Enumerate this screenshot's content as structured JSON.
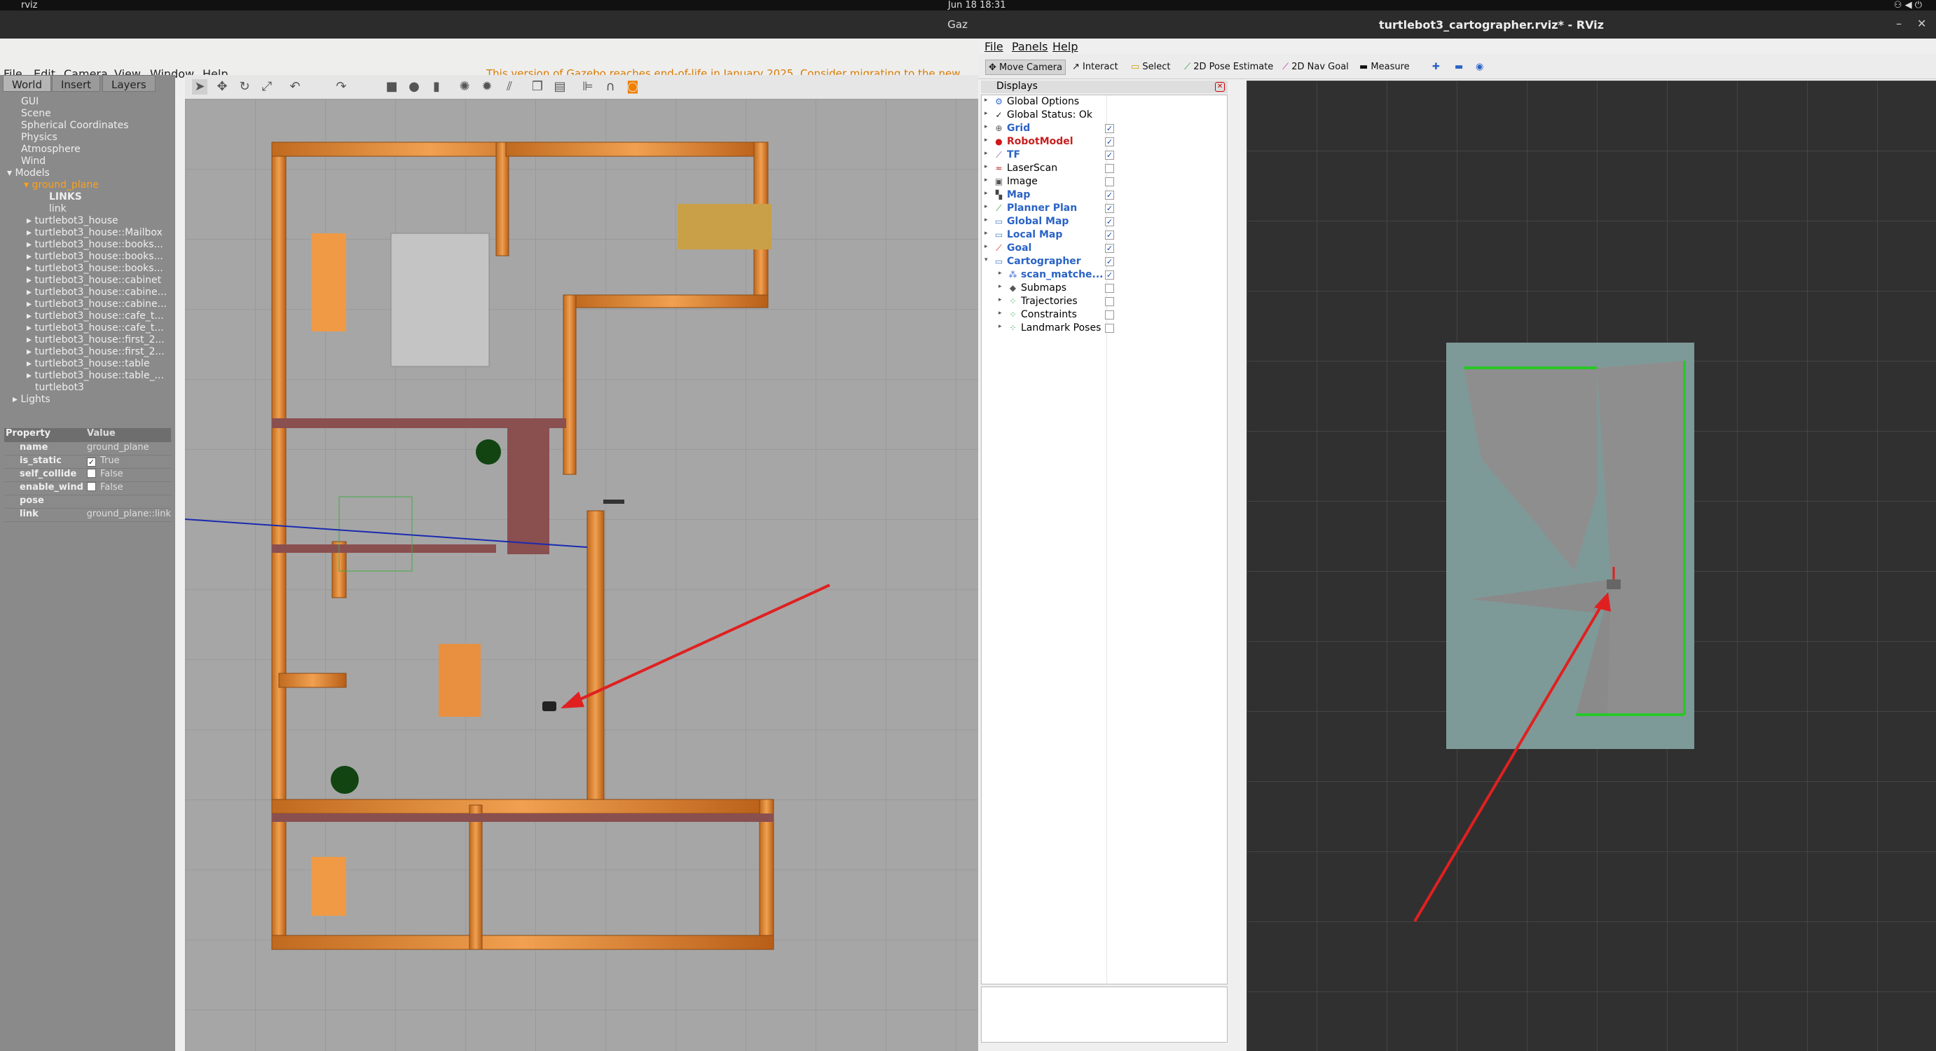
{
  "system": {
    "app": "rviz",
    "datetime": "Jun 18  18:31"
  },
  "gazebo": {
    "window_title": "Gaz",
    "menu": [
      "File",
      "Edit",
      "Camera",
      "View",
      "Window",
      "Help"
    ],
    "eol_notice": "This version of Gazebo reaches end-of-life in January 2025. Consider ",
    "eol_link": "migrating to the new Gazebo",
    "tabs": [
      "World",
      "Insert",
      "Layers"
    ],
    "tree": [
      "GUI",
      "Scene",
      "Spherical Coordinates",
      "Physics",
      "Atmosphere",
      "Wind",
      "Models",
      "ground_plane",
      "LINKS",
      "link",
      "turtlebot3_house",
      "turtlebot3_house::Mailbox",
      "turtlebot3_house::books...",
      "turtlebot3_house::books...",
      "turtlebot3_house::books...",
      "turtlebot3_house::cabinet",
      "turtlebot3_house::cabine...",
      "turtlebot3_house::cabine...",
      "turtlebot3_house::cafe_t...",
      "turtlebot3_house::cafe_t...",
      "turtlebot3_house::first_2...",
      "turtlebot3_house::first_2...",
      "turtlebot3_house::table",
      "turtlebot3_house::table_...",
      "turtlebot3",
      "Lights"
    ],
    "props": {
      "header": [
        "Property",
        "Value"
      ],
      "rows": [
        {
          "k": "name",
          "v": "ground_plane"
        },
        {
          "k": "is_static",
          "v": "True",
          "checked": true
        },
        {
          "k": "self_collide",
          "v": "False",
          "checked": false
        },
        {
          "k": "enable_wind",
          "v": "False",
          "checked": false
        },
        {
          "k": "pose",
          "v": ""
        },
        {
          "k": "link",
          "v": "ground_plane::link"
        }
      ]
    }
  },
  "rviz": {
    "window_title": "turtlebot3_cartographer.rviz* - RViz",
    "menu": [
      "File",
      "Panels",
      "Help"
    ],
    "tools": [
      "Move Camera",
      "Interact",
      "Select",
      "2D Pose Estimate",
      "2D Nav Goal",
      "Measure"
    ],
    "displays_title": "Displays",
    "displays": [
      {
        "label": "Global Options",
        "style": "normal",
        "check": null,
        "icon": "gear-icon",
        "glyph": "⚙",
        "color": "#3a6fd0",
        "indent": 0
      },
      {
        "label": "Global Status: Ok",
        "style": "normal",
        "check": null,
        "icon": "check-icon",
        "glyph": "✓",
        "color": "#222222",
        "indent": 0
      },
      {
        "label": "Grid",
        "style": "blue",
        "check": true,
        "icon": "grid-icon",
        "glyph": "⊕",
        "color": "#555555",
        "indent": 0
      },
      {
        "label": "RobotModel",
        "style": "red",
        "check": true,
        "icon": "error-icon",
        "glyph": "●",
        "color": "#d01818",
        "indent": 0
      },
      {
        "label": "TF",
        "style": "blue",
        "check": true,
        "icon": "tf-icon",
        "glyph": "⟋",
        "color": "#7a3fa0",
        "indent": 0
      },
      {
        "label": "LaserScan",
        "style": "normal",
        "check": false,
        "icon": "laser-icon",
        "glyph": "≈",
        "color": "#c02020",
        "indent": 0
      },
      {
        "label": "Image",
        "style": "normal",
        "check": false,
        "icon": "image-icon",
        "glyph": "▣",
        "color": "#555555",
        "indent": 0
      },
      {
        "label": "Map",
        "style": "blue",
        "check": true,
        "icon": "map-icon",
        "glyph": "▚",
        "color": "#444444",
        "indent": 0
      },
      {
        "label": "Planner Plan",
        "style": "blue",
        "check": true,
        "icon": "path-icon",
        "glyph": "⟋",
        "color": "#1a9a2a",
        "indent": 0
      },
      {
        "label": "Global Map",
        "style": "blue",
        "check": true,
        "icon": "folder-icon",
        "glyph": "▭",
        "color": "#4a82c8",
        "indent": 0
      },
      {
        "label": "Local Map",
        "style": "blue",
        "check": true,
        "icon": "folder-icon",
        "glyph": "▭",
        "color": "#4a82c8",
        "indent": 0
      },
      {
        "label": "Goal",
        "style": "blue",
        "check": true,
        "icon": "goal-icon",
        "glyph": "⟋",
        "color": "#d01818",
        "indent": 0
      },
      {
        "label": "Cartographer",
        "style": "blue",
        "check": true,
        "icon": "folder-icon",
        "glyph": "▭",
        "color": "#4a82c8",
        "indent": 0,
        "open": true
      },
      {
        "label": "scan_matche...",
        "style": "blue",
        "check": true,
        "icon": "points-icon",
        "glyph": "⁂",
        "color": "#3a6fd0",
        "indent": 1
      },
      {
        "label": "Submaps",
        "style": "normal",
        "check": false,
        "icon": "submaps-icon",
        "glyph": "◆",
        "color": "#555555",
        "indent": 1
      },
      {
        "label": "Trajectories",
        "style": "normal",
        "check": false,
        "icon": "markers-icon",
        "glyph": "⁘",
        "color": "#2a9a3a",
        "indent": 1
      },
      {
        "label": "Constraints",
        "style": "normal",
        "check": false,
        "icon": "markers-icon",
        "glyph": "⁘",
        "color": "#2a9a3a",
        "indent": 1
      },
      {
        "label": "Landmark Poses",
        "style": "normal",
        "check": false,
        "icon": "markers-icon",
        "glyph": "⁘",
        "color": "#2a9a3a",
        "indent": 1
      }
    ]
  }
}
